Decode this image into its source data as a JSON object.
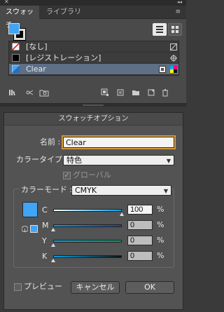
{
  "panel": {
    "tabs": [
      {
        "label": "スウォッチ",
        "active": true
      },
      {
        "label": "ライブラリ",
        "active": false
      }
    ],
    "fill_color": "#42a4f5",
    "swatches": [
      {
        "label": "[なし]",
        "chip": "none",
        "selected": false
      },
      {
        "label": "[レジストレーション]",
        "chip": "registration",
        "selected": false
      },
      {
        "label": "Clear",
        "chip": "clear-spot",
        "selected": true
      }
    ],
    "selection_color": "#5e6f86"
  },
  "dialog": {
    "title": "スウォッチオプション",
    "name_label": "名前 :",
    "name_value": "Clear",
    "color_type_label": "カラータイプ :",
    "color_type_value": "特色",
    "global_label": "グローバル",
    "global_checked": true,
    "color_mode_label": "カラーモード :",
    "color_mode_value": "CMYK",
    "swatch_color": "#42a4f5",
    "channels": [
      {
        "name": "C",
        "value": "100",
        "unit": "%",
        "fraction": 1.0
      },
      {
        "name": "M",
        "value": "0",
        "unit": "%",
        "fraction": 0.0
      },
      {
        "name": "Y",
        "value": "0",
        "unit": "%",
        "fraction": 0.0
      },
      {
        "name": "K",
        "value": "0",
        "unit": "%",
        "fraction": 0.0
      }
    ],
    "preview_label": "プレビュー",
    "preview_checked": false,
    "cancel_label": "キャンセル",
    "ok_label": "OK",
    "focus_color": "#d79b3c"
  }
}
